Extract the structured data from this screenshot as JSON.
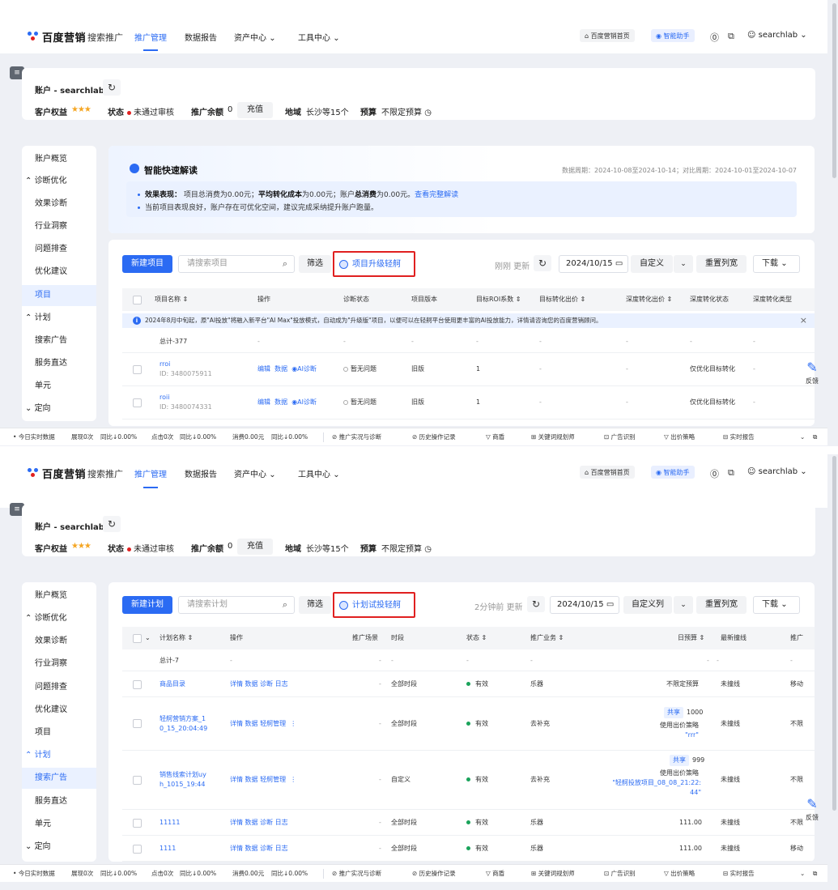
{
  "nav": {
    "brand": "百度营销",
    "product": "搜索推广",
    "items": [
      "推广管理",
      "数据报告",
      "资产中心",
      "工具中心"
    ],
    "home_btn": "百度营销首页",
    "assistant_btn": "智能助手",
    "user": "searchlab"
  },
  "account": {
    "name": "账户 - searchlab",
    "rights_label": "客户权益",
    "stars": "★★★",
    "status_label": "状态",
    "status_value": "未通过审核",
    "balance_label": "推广余额",
    "balance_value": "0",
    "charge_btn": "充值",
    "region_label": "地域",
    "region_value": "长沙等15个",
    "budget_label": "预算",
    "budget_value": "不限定预算"
  },
  "sidebar1": [
    "账户概览",
    "诊断优化",
    "效果诊断",
    "行业洞察",
    "问题排查",
    "优化建议",
    "项目",
    "计划",
    "搜索广告",
    "服务直达",
    "单元",
    "定向"
  ],
  "sidebar2": [
    "账户概览",
    "诊断优化",
    "效果诊断",
    "行业洞察",
    "问题排查",
    "优化建议",
    "项目",
    "计划",
    "搜索广告",
    "服务直达",
    "单元",
    "定向"
  ],
  "smart": {
    "title": "智能快速解读",
    "period": "数据周期：2024-10-08至2024-10-14；对比周期：2024-10-01至2024-10-07",
    "line1_prefix": "效果表现：",
    "line1_a": "项目总消费",
    "line1_b": "为0.00元；",
    "line1_c": "平均转化成本",
    "line1_d": "为0.00元；账户",
    "line1_e": "总消费",
    "line1_f": "为0.00元。",
    "line1_link": "查看完整解读",
    "line2": "当前项目表现良好，账户存在可优化空间，建议完成采纳提升账户跑量。"
  },
  "panel1": {
    "new_btn": "新建项目",
    "search_placeholder": "请搜索项目",
    "filter_btn": "筛选",
    "upgrade_btn": "项目升级轻舸",
    "update_text": "刚刚 更新",
    "date": "2024/10/15",
    "custom_btn": "自定义",
    "reset_btn": "重置列宽",
    "download_btn": "下载",
    "headers": [
      "项目名称",
      "操作",
      "诊断状态",
      "项目版本",
      "目标ROI系数",
      "目标转化出价",
      "深度转化出价",
      "深度转化状态",
      "深度转化类型"
    ],
    "notice": "2024年8月中旬起，原\"AI投放\"将融入新平台\"AI Max\"投放模式，自动成为\"升级版\"项目，以便可以在轻舸平台使用更丰富的AI投放能力，详情请咨询您的百度营销顾问。",
    "total": "总计-377",
    "dash": "-",
    "rows": [
      {
        "name": "rroi",
        "id": "ID: 3480075911",
        "ops": [
          "编辑",
          "数据",
          "AI诊断"
        ],
        "diag": "暂无问题",
        "version": "旧版",
        "roi": "1",
        "target": "-",
        "deep_bid": "-",
        "deep_status": "仅优化目标转化",
        "deep_type": "-"
      },
      {
        "name": "roii",
        "id": "ID: 3480074331",
        "ops": [
          "编辑",
          "数据",
          "AI诊断"
        ],
        "diag": "暂无问题",
        "version": "旧版",
        "roi": "1",
        "target": "-",
        "deep_bid": "-",
        "deep_status": "仅优化目标转化",
        "deep_type": "-"
      }
    ]
  },
  "panel2": {
    "new_btn": "新建计划",
    "search_placeholder": "请搜索计划",
    "filter_btn": "筛选",
    "upgrade_btn": "计划试投轻舸",
    "update_text": "2分钟前 更新",
    "date": "2024/10/15",
    "custom_btn": "自定义列",
    "reset_btn": "重置列宽",
    "download_btn": "下载",
    "headers": [
      "计划名称",
      "操作",
      "推广场景",
      "时段",
      "状态",
      "推广业务",
      "日预算",
      "最新撞线",
      "推广"
    ],
    "total": "总计-7",
    "dash": "-",
    "rows": [
      {
        "name": "商品目录",
        "ops": [
          "详情",
          "数据",
          "诊断",
          "日志"
        ],
        "scene": "-",
        "period": "全部时段",
        "status": "有效",
        "biz": "乐器",
        "budget": "不限定预算",
        "hit": "未撞线",
        "last": "移动"
      },
      {
        "name": "轻舸营销方案_10_15_20:04:49",
        "name_l1": "轻舸营销方案_1",
        "name_l2": "0_15_20:04:49",
        "ops": [
          "详情",
          "数据",
          "轻舸管理"
        ],
        "scene": "-",
        "period": "全部时段",
        "status": "有效",
        "biz": "去补充",
        "shared": "共享",
        "budget": "1000",
        "bid_label": "使用出价策略",
        "bid_value": "\"rrr\"",
        "hit": "未撞线",
        "last": "不限"
      },
      {
        "name": "销售线索计划uyh_1015_19:44",
        "name_l1": "销售线索计划uy",
        "name_l2": "h_1015_19:44",
        "ops": [
          "详情",
          "数据",
          "轻舸管理"
        ],
        "scene": "-",
        "period": "自定义",
        "status": "有效",
        "biz": "去补充",
        "shared": "共享",
        "budget": "999",
        "bid_label": "使用出价策略",
        "bid_value_l1": "\"轻舸投放项目_08_08_21:22:",
        "bid_value_l2": "44\"",
        "hit": "未撞线",
        "last": "不限"
      },
      {
        "name": "11111",
        "ops": [
          "详情",
          "数据",
          "诊断",
          "日志"
        ],
        "scene": "-",
        "period": "全部时段",
        "status": "有效",
        "biz": "乐器",
        "budget": "111.00",
        "hit": "未撞线",
        "last": "不限"
      },
      {
        "name": "1111",
        "ops": [
          "详情",
          "数据",
          "诊断",
          "日志"
        ],
        "scene": "-",
        "period": "全部时段",
        "status": "有效",
        "biz": "乐器",
        "budget": "111.00",
        "hit": "未撞线",
        "last": "移动"
      }
    ]
  },
  "feedback": "反馈",
  "statusbar": {
    "realtime": "今日实时数据",
    "impressions": "展现0次",
    "imp_cmp": "同比↓0.00%",
    "clicks": "点击0次",
    "clk_cmp": "同比↓0.00%",
    "cost": "消费0.00元",
    "cost_cmp": "同比↓0.00%",
    "tools": [
      "推广实况与诊断",
      "历史操作记录",
      "商盾",
      "关键词规划师",
      "广告识别",
      "出价策略",
      "实时报告"
    ]
  }
}
